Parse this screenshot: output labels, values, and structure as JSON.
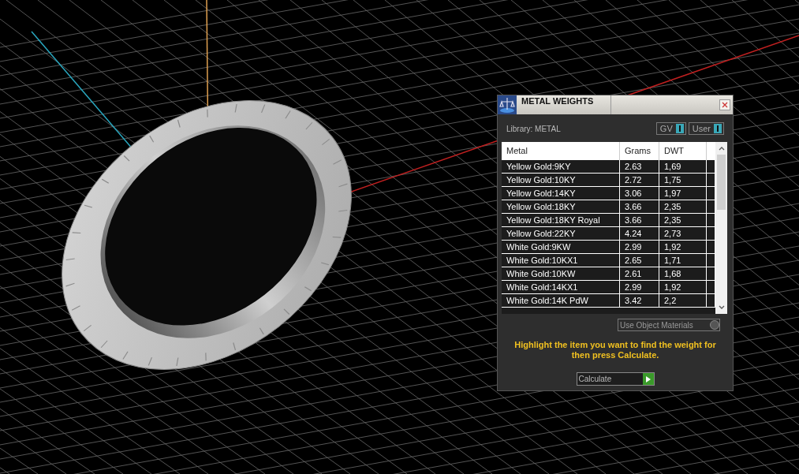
{
  "panel": {
    "title": "METAL WEIGHTS",
    "library_label": "Library: METAL",
    "toggles": [
      {
        "label": "GV",
        "on": true
      },
      {
        "label": "User",
        "on": true
      }
    ],
    "table": {
      "columns": [
        "Metal",
        "Grams",
        "DWT"
      ],
      "rows": [
        {
          "cells": [
            "Yellow Gold:9KY",
            "2.63",
            "1,69"
          ]
        },
        {
          "cells": [
            "Yellow Gold:10KY",
            "2.72",
            "1,75"
          ]
        },
        {
          "cells": [
            "Yellow Gold:14KY",
            "3.06",
            "1,97"
          ]
        },
        {
          "cells": [
            "Yellow Gold:18KY",
            "3.66",
            "2,35"
          ]
        },
        {
          "cells": [
            "Yellow Gold:18KY Royal",
            "3.66",
            "2,35"
          ]
        },
        {
          "cells": [
            "Yellow Gold:22KY",
            "4.24",
            "2,73"
          ]
        },
        {
          "cells": [
            "White Gold:9KW",
            "2.99",
            "1,92"
          ]
        },
        {
          "cells": [
            "White Gold:10KX1",
            "2.65",
            "1,71"
          ]
        },
        {
          "cells": [
            "White Gold:10KW",
            "2.61",
            "1,68"
          ]
        },
        {
          "cells": [
            "White Gold:14KX1",
            "2.99",
            "1,92"
          ]
        },
        {
          "cells": [
            "White Gold:14K PdW",
            "3.42",
            "2,2"
          ]
        }
      ]
    },
    "use_object_materials": {
      "label": "Use Object Materials",
      "on": false
    },
    "hint": "Highlight the item you want to find the weight for then press Calculate.",
    "calculate_button": "Calculate"
  }
}
